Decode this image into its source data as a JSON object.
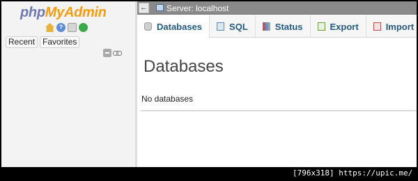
{
  "logo": {
    "php": "php",
    "my": "My",
    "admin": "Admin"
  },
  "nav": {
    "icons": [
      "home-icon",
      "help-icon",
      "documentation-icon",
      "reload-icon"
    ],
    "tabs": [
      "Recent",
      "Favorites"
    ],
    "controls": [
      "collapse-all-icon",
      "link-with-main-panel-icon"
    ]
  },
  "serverbar": {
    "back": "←",
    "label": "Server: localhost"
  },
  "tabs": [
    {
      "label": "Databases",
      "icon": "database-icon"
    },
    {
      "label": "SQL",
      "icon": "sql-icon"
    },
    {
      "label": "Status",
      "icon": "status-icon"
    },
    {
      "label": "Export",
      "icon": "export-icon"
    },
    {
      "label": "Import",
      "icon": "import-icon"
    }
  ],
  "main": {
    "title": "Databases",
    "empty_message": "No databases"
  },
  "watermark": "[796x318] https://upic.me/",
  "colors": {
    "accent": "#235a81",
    "logo_blue": "#6c78af",
    "logo_orange": "#f89c0e"
  }
}
